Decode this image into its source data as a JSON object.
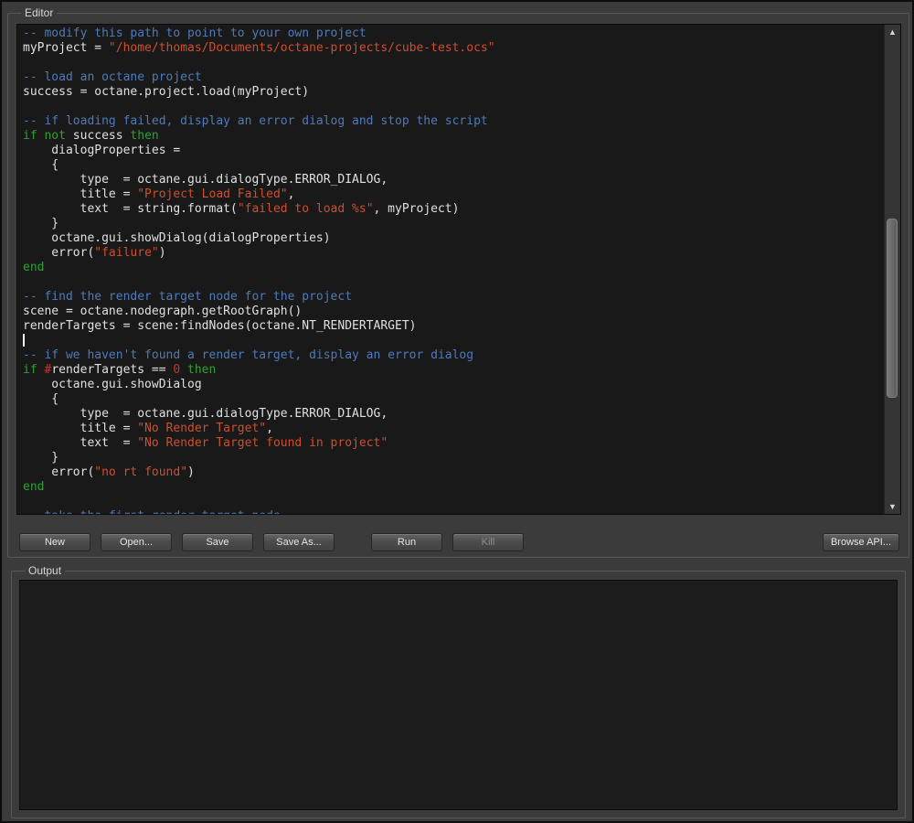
{
  "window": {
    "bg": "#3b3b3b"
  },
  "editor": {
    "label": "Editor",
    "buttons": [
      {
        "id": "new",
        "label": "New",
        "enabled": true
      },
      {
        "id": "open",
        "label": "Open...",
        "enabled": true
      },
      {
        "id": "save",
        "label": "Save",
        "enabled": true
      },
      {
        "id": "save-as",
        "label": "Save As...",
        "enabled": true
      },
      {
        "id": "run",
        "label": "Run",
        "enabled": true
      },
      {
        "id": "kill",
        "label": "Kill",
        "enabled": false
      },
      {
        "id": "browse-api",
        "label": "Browse API...",
        "enabled": true
      }
    ]
  },
  "output": {
    "label": "Output",
    "content": ""
  },
  "scrollbar": {
    "up_glyph": "▲",
    "down_glyph": "▼"
  },
  "code": {
    "language": "lua",
    "token_colors": {
      "plain": "#e0e0e0",
      "comment": "#4f7ab8",
      "keyword": "#33a033",
      "string": "#cd4f2e",
      "number": "#cc3328",
      "operator": "#cc3328"
    },
    "lines": [
      [
        [
          "comment",
          "-- modify this path to point to your own project"
        ]
      ],
      [
        [
          "plain",
          "myProject = "
        ],
        [
          "string",
          "\"/home/thomas/Documents/octane-projects/cube-test.ocs\""
        ]
      ],
      [],
      [
        [
          "comment",
          "-- load an octane project"
        ]
      ],
      [
        [
          "plain",
          "success = octane.project.load(myProject)"
        ]
      ],
      [],
      [
        [
          "comment",
          "-- if loading failed, display an error dialog and stop the script"
        ]
      ],
      [
        [
          "keyword",
          "if"
        ],
        [
          "plain",
          " "
        ],
        [
          "keyword",
          "not"
        ],
        [
          "plain",
          " success "
        ],
        [
          "keyword",
          "then"
        ]
      ],
      [
        [
          "plain",
          "    dialogProperties ="
        ]
      ],
      [
        [
          "plain",
          "    {"
        ]
      ],
      [
        [
          "plain",
          "        type  = octane.gui.dialogType.ERROR_DIALOG,"
        ]
      ],
      [
        [
          "plain",
          "        title = "
        ],
        [
          "string",
          "\"Project Load Failed\""
        ],
        [
          "plain",
          ","
        ]
      ],
      [
        [
          "plain",
          "        text  = string.format("
        ],
        [
          "string",
          "\"failed to load %s\""
        ],
        [
          "plain",
          ", myProject)"
        ]
      ],
      [
        [
          "plain",
          "    }"
        ]
      ],
      [
        [
          "plain",
          "    octane.gui.showDialog(dialogProperties)"
        ]
      ],
      [
        [
          "plain",
          "    error("
        ],
        [
          "string",
          "\"failure\""
        ],
        [
          "plain",
          ")"
        ]
      ],
      [
        [
          "keyword",
          "end"
        ]
      ],
      [],
      [
        [
          "comment",
          "-- find the render target node for the project"
        ]
      ],
      [
        [
          "plain",
          "scene = octane.nodegraph.getRootGraph()"
        ]
      ],
      [
        [
          "plain",
          "renderTargets = scene:findNodes(octane.NT_RENDERTARGET)"
        ]
      ],
      [
        [
          "caret",
          ""
        ]
      ],
      [
        [
          "comment",
          "-- if we haven't found a render target, display an error dialog"
        ]
      ],
      [
        [
          "keyword",
          "if"
        ],
        [
          "plain",
          " "
        ],
        [
          "operator",
          "#"
        ],
        [
          "plain",
          "renderTargets == "
        ],
        [
          "number",
          "0"
        ],
        [
          "plain",
          " "
        ],
        [
          "keyword",
          "then"
        ]
      ],
      [
        [
          "plain",
          "    octane.gui.showDialog"
        ]
      ],
      [
        [
          "plain",
          "    {"
        ]
      ],
      [
        [
          "plain",
          "        type  = octane.gui.dialogType.ERROR_DIALOG,"
        ]
      ],
      [
        [
          "plain",
          "        title = "
        ],
        [
          "string",
          "\"No Render Target\""
        ],
        [
          "plain",
          ","
        ]
      ],
      [
        [
          "plain",
          "        text  = "
        ],
        [
          "string",
          "\"No Render Target found in project\""
        ]
      ],
      [
        [
          "plain",
          "    }"
        ]
      ],
      [
        [
          "plain",
          "    error("
        ],
        [
          "string",
          "\"no rt found\""
        ],
        [
          "plain",
          ")"
        ]
      ],
      [
        [
          "keyword",
          "end"
        ]
      ],
      [],
      [
        [
          "comment",
          "-- take the first render target node"
        ]
      ]
    ]
  }
}
